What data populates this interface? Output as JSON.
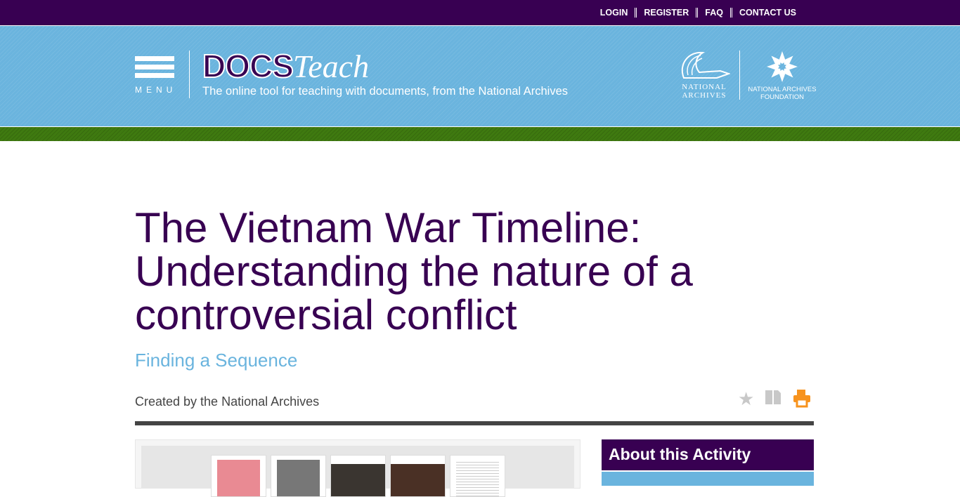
{
  "topnav": {
    "items": [
      "LOGIN",
      "REGISTER",
      "FAQ",
      "CONTACT US"
    ]
  },
  "header": {
    "menu_label": "MENU",
    "logo_docs": "DOCS",
    "logo_teach": "Teach",
    "tagline": "The online tool for teaching with documents, from the National Archives",
    "na_logo": "NATIONAL ARCHIVES",
    "naf_logo": "NATIONAL ARCHIVES FOUNDATION"
  },
  "page": {
    "title": "The Vietnam War Timeline: Understanding the nature of a controversial conflict",
    "subtitle": "Finding a Sequence",
    "created_by": "Created by the National Archives"
  },
  "sidebar": {
    "about_title": "About this Activity"
  },
  "colors": {
    "purple": "#380052",
    "blue": "#6ab4de",
    "green": "#3f7a10",
    "print": "#f7931e"
  }
}
